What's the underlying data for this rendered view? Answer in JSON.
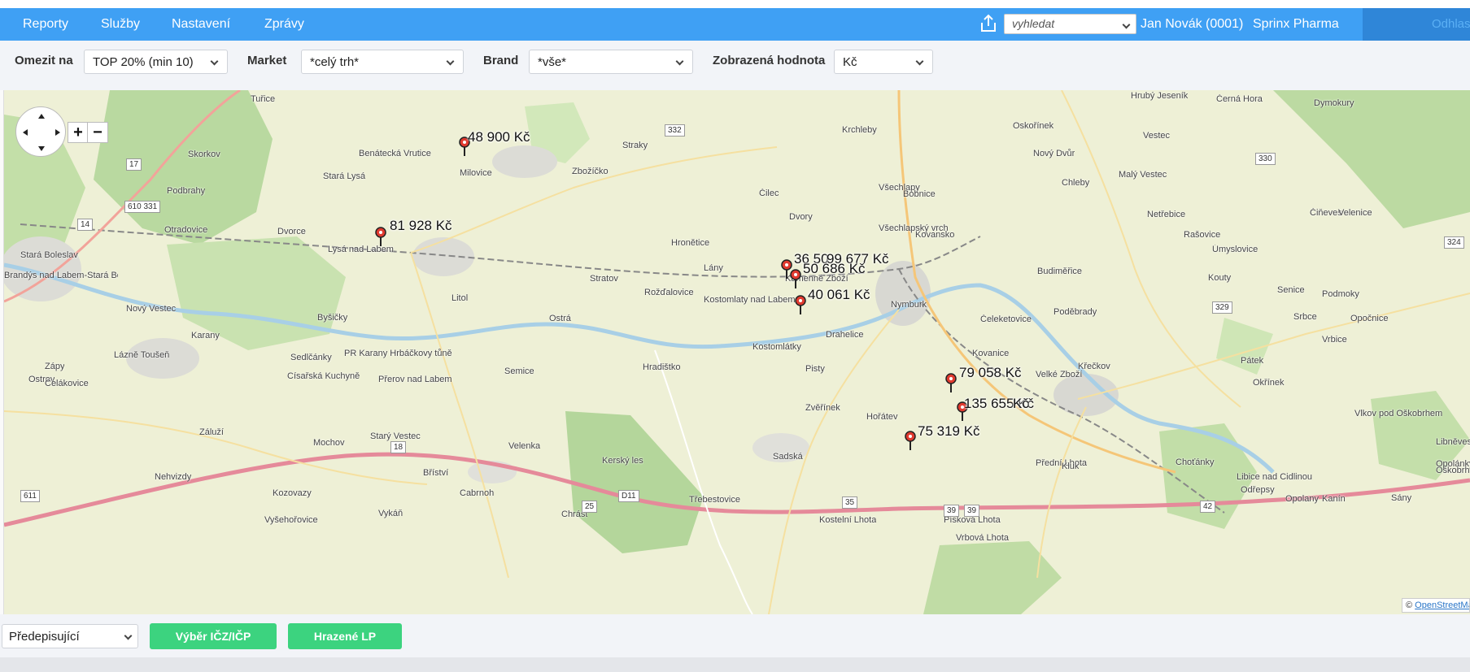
{
  "nav": {
    "items": [
      "Reporty",
      "Služby",
      "Nastavení",
      "Zprávy"
    ],
    "search_value": "vyhledat",
    "user": "Jan Novák (0001)",
    "company": "Sprinx Pharma",
    "logout": "Odhlas"
  },
  "filters": {
    "limit_label": "Omezit na",
    "limit_value": "TOP 20% (min 10)",
    "market_label": "Market",
    "market_value": "*celý trh*",
    "brand_label": "Brand",
    "brand_value": "*vše*",
    "display_label": "Zobrazená hodnota",
    "display_value": "Kč"
  },
  "map": {
    "attribution_prefix": "©",
    "attribution_link": "OpenStreetMap",
    "markers": [
      {
        "label": "48 900 Kč"
      },
      {
        "label": "81 928 Kč"
      },
      {
        "label": "36 50"
      },
      {
        "label": "99 677 Kč"
      },
      {
        "label": "50 686 Kč"
      },
      {
        "label": "40 061 Kč"
      },
      {
        "label": "79 058 Kč"
      },
      {
        "label": "135 655 Kč"
      },
      {
        "label": "Kč"
      },
      {
        "label": "75 319 Kč"
      }
    ],
    "places": [
      "Tuřice",
      "Skorkov",
      "Podbrahy",
      "Otradovice",
      "Stará Boleslav",
      "Brandýs nad Labem-Stará Boleslav",
      "Benátecká Vrutice",
      "Stará Lysá",
      "Dvorce",
      "Lysá nad Labem",
      "Milovice",
      "Zbožíčko",
      "Straky",
      "Krchleby",
      "Oskořínek",
      "Hrubý Jeseník",
      "Černá Hora",
      "Dymokury",
      "Vestec",
      "Malý Vestec",
      "Nový Dvůr",
      "Chleby",
      "Všechlapy",
      "Bobnice",
      "Čilec",
      "Dvory",
      "Všechlapský vrch",
      "Kovansko",
      "Hronětice",
      "Lány",
      "Stratov",
      "Kamenné Zboží",
      "Rožďalovice",
      "Kostomlaty nad Labem",
      "Litol",
      "Nymburk",
      "Budiměřice",
      "Ostrá",
      "Nový Vestec",
      "Byšičky",
      "Karany",
      "Lázně Toušeň",
      "Zápy",
      "Ostrov",
      "Sedlčánky",
      "Císařská Kuchyně",
      "PR Karany Hrbáčkovy tůně",
      "Přerov nad Labem",
      "Semice",
      "Hradištko",
      "Kostomlátky",
      "Drahelice",
      "Pisty",
      "Kovanice",
      "Velké Zboží",
      "Poděbrady",
      "Křečkov",
      "Pátek",
      "Okřínek",
      "Srbce",
      "Vrbice",
      "Opočnice",
      "Čeleketovice",
      "Čelákovice",
      "Záluží",
      "Mochov",
      "Starý Vestec",
      "Velenka",
      "Kerský les",
      "Sadská",
      "Zvěřínek",
      "Hořátev",
      "Přední Lhota",
      "Kluk",
      "Choťánky",
      "Odřepsy",
      "Libice nad Cidlinou",
      "Opolany",
      "Kanín",
      "Sány",
      "Oškobrh",
      "Libněves",
      "Nehvizdy",
      "Kozovazy",
      "Bříství",
      "Cabrnoh",
      "Vyšehořovice",
      "Vykáň",
      "Chrást",
      "Třebestovice",
      "Kostelní Lhota",
      "Písková Lhota",
      "Vrbová Lhota",
      "Netřebice",
      "Rašovice",
      "Úmyslovice",
      "Kouty",
      "Senice",
      "Podmoky",
      "Čiňeves",
      "Velenice",
      "Vlkov pod Oškobrhem",
      "Opolánky"
    ],
    "road_numbers": [
      "332",
      "330",
      "324",
      "329",
      "610 331",
      "611",
      "17",
      "14",
      "D11",
      "18",
      "25",
      "35",
      "39",
      "39",
      "42"
    ]
  },
  "bottom": {
    "select_value": "Předepisující",
    "btn_icz": "Výběr IČZ/IČP",
    "btn_hrazene": "Hrazené LP"
  }
}
